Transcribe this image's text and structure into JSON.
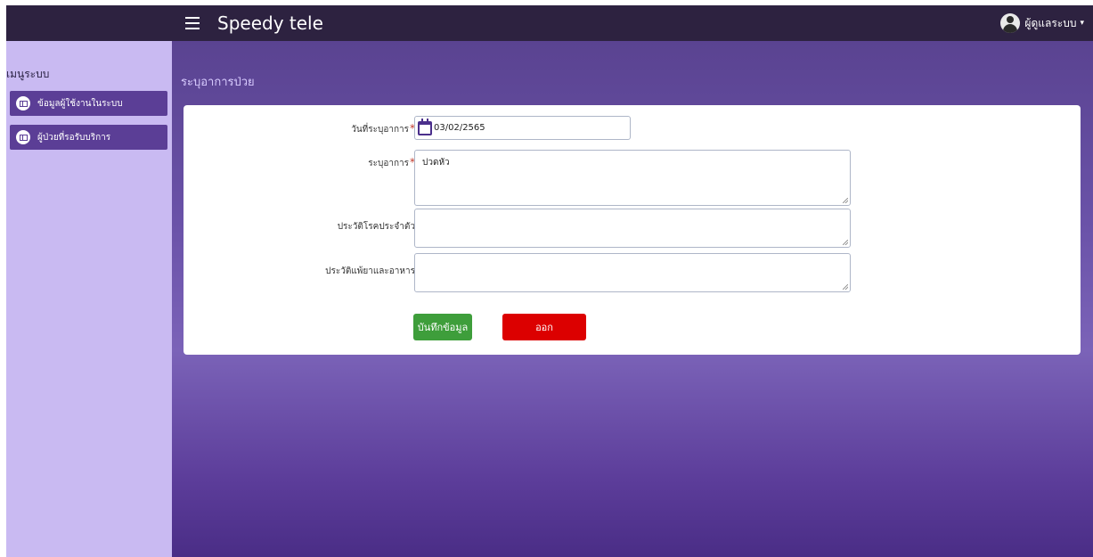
{
  "header": {
    "brand": "Speedy tele",
    "user_label": "ผู้ดูแลระบบ",
    "caret": "▾"
  },
  "sidebar": {
    "title": "เมนูระบบ",
    "items": [
      {
        "label": "ข้อมูลผู้ใช้งานในระบบ"
      },
      {
        "label": "ผู้ป่วยที่รอรับบริการ"
      }
    ]
  },
  "main": {
    "page_title": "ระบุอาการป่วย",
    "form": {
      "date_label": "วันที่ระบุอาการ",
      "date_value": "03/02/2565",
      "symptom_label": "ระบุอาการ",
      "symptom_value": "ปวดหัว",
      "disease_history_label": "ประวัติโรคประจำตัว",
      "disease_history_value": "",
      "allergy_label": "ประวัติแพ้ยาและอาหาร",
      "allergy_value": "",
      "required_mark": "*"
    },
    "buttons": {
      "save": "บันทึกข้อมูล",
      "exit": "ออก"
    }
  },
  "colors": {
    "topbar": "#2d2240",
    "sidebar": "#c9baf2",
    "sidebar_item": "#5b3e96",
    "save_button": "#3e9e3b",
    "exit_button": "#dc0000"
  }
}
